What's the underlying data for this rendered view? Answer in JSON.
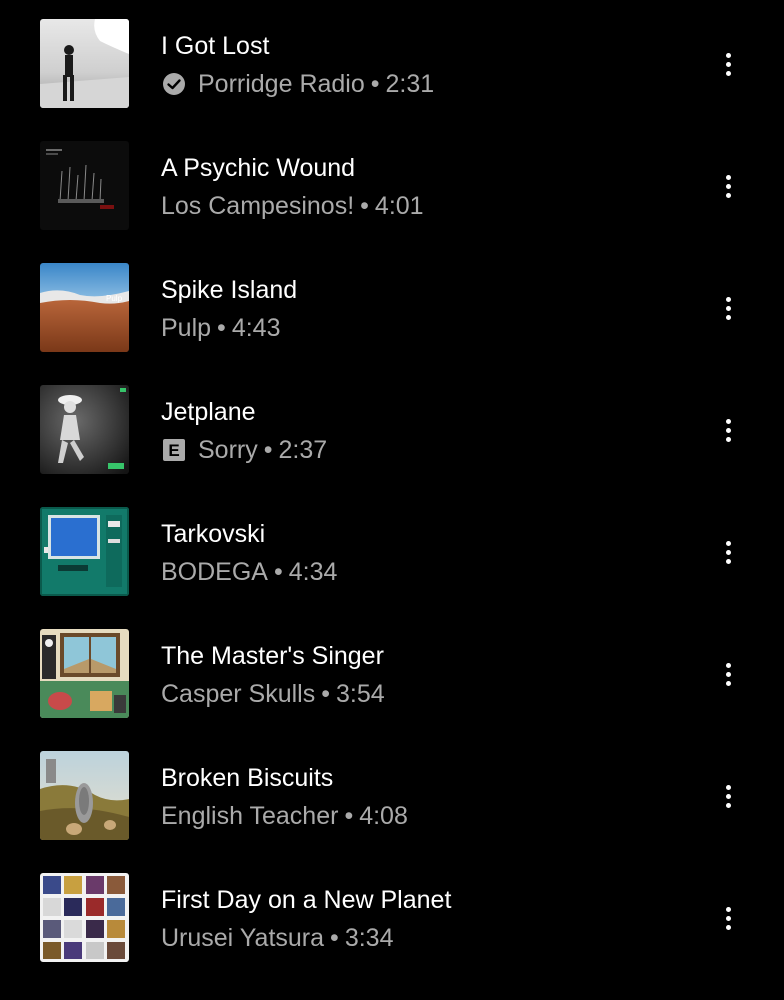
{
  "songs": [
    {
      "title": "I Got Lost",
      "artist": "Porridge Radio",
      "separator": "•",
      "duration": "2:31",
      "badge": "verified-check",
      "art": "i-got-lost-cover"
    },
    {
      "title": "A Psychic Wound",
      "artist": "Los Campesinos!",
      "separator": "•",
      "duration": "4:01",
      "badge": null,
      "art": "a-psychic-wound-cover"
    },
    {
      "title": "Spike Island",
      "artist": "Pulp",
      "separator": "•",
      "duration": "4:43",
      "badge": null,
      "art": "spike-island-cover"
    },
    {
      "title": "Jetplane",
      "artist": "Sorry",
      "separator": "•",
      "duration": "2:37",
      "badge": "explicit",
      "badge_label": "E",
      "art": "jetplane-cover"
    },
    {
      "title": "Tarkovski",
      "artist": "BODEGA",
      "separator": "•",
      "duration": "4:34",
      "badge": null,
      "art": "tarkovski-cover"
    },
    {
      "title": "The Master's Singer",
      "artist": "Casper Skulls",
      "separator": "•",
      "duration": "3:54",
      "badge": null,
      "art": "the-masters-singer-cover"
    },
    {
      "title": "Broken Biscuits",
      "artist": "English Teacher",
      "separator": "•",
      "duration": "4:08",
      "badge": null,
      "art": "broken-biscuits-cover"
    },
    {
      "title": "First Day on a New Planet",
      "artist": "Urusei Yatsura",
      "separator": "•",
      "duration": "3:34",
      "badge": null,
      "art": "first-day-cover"
    }
  ],
  "icons": {
    "menu": "more-vert-icon",
    "verified": "verified-check-icon",
    "explicit": "explicit-icon"
  },
  "colors": {
    "background": "#000000",
    "title": "#ffffff",
    "subtitle": "#aaaaaa"
  }
}
